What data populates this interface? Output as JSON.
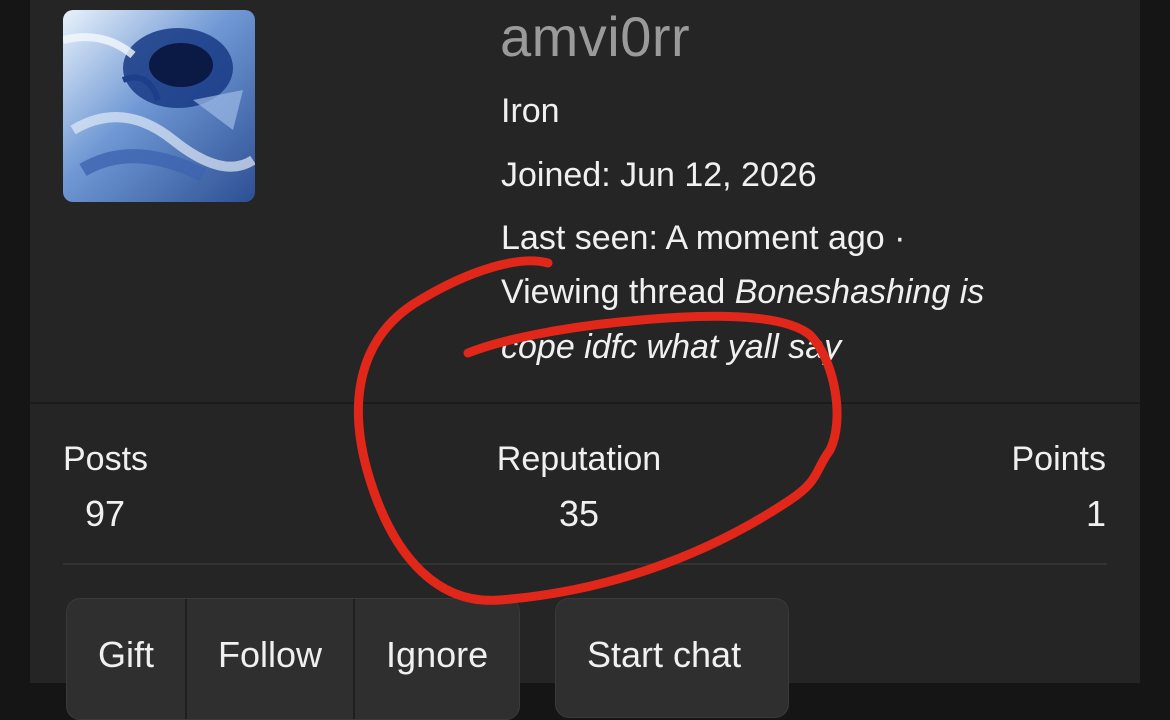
{
  "profile": {
    "username": "amvi0rr",
    "rank": "Iron",
    "joined": "Joined: Jun 12, 2026",
    "last_seen": "Last seen: A moment ago ·",
    "activity_prefix": "Viewing thread ",
    "thread_title_part1": "Boneshashing is",
    "thread_title_part2": "cope idfc what yall say"
  },
  "stats": [
    {
      "label": "Posts",
      "value": "97"
    },
    {
      "label": "Reputation",
      "value": "35"
    },
    {
      "label": "Points",
      "value": "1"
    }
  ],
  "actions": {
    "gift": "Gift",
    "follow": "Follow",
    "ignore": "Ignore",
    "start_chat": "Start chat"
  },
  "colors": {
    "background": "#151515",
    "card": "#252525",
    "username": "#9a9a9a",
    "text": "#f0f0f0",
    "annotation_stroke": "#e0271a"
  },
  "icons": {
    "avatar": "user-avatar-image",
    "annotation": "red-hand-drawn-circle"
  }
}
